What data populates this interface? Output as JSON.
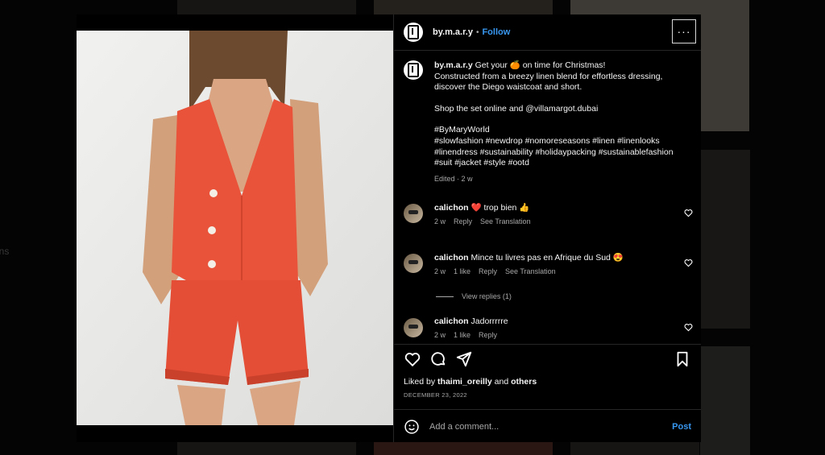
{
  "background": {
    "sidebar_fragments": [
      "s",
      "ons"
    ]
  },
  "post": {
    "username": "by.m.a.r.y",
    "follow_label": "Follow",
    "more_label": "···",
    "caption": {
      "username": "by.m.a.r.y",
      "line1": "Get your 🍊 on time for Christmas!",
      "line2": "Constructed from a breezy linen blend for effortless dressing,",
      "line3": "discover the Diego waistcoat and short.",
      "line4": "Shop the set online and @villamargot.dubai",
      "line5": "#ByMaryWorld",
      "line6": "#slowfashion #newdrop #nomoreseasons #linen #linenlooks",
      "line7": "#linendress #sustainability #holidaypacking #sustainablefashion",
      "line8": "#suit #jacket #style #ootd",
      "meta": "Edited · 2 w"
    },
    "comments": [
      {
        "username": "calichon",
        "text": "❤️ trop bien 👍",
        "time": "2 w",
        "likes": "",
        "reply": "Reply",
        "translate": "See Translation"
      },
      {
        "username": "calichon",
        "text": "Mince tu livres pas en Afrique du Sud 😍",
        "time": "2 w",
        "likes": "1 like",
        "reply": "Reply",
        "translate": "See Translation"
      },
      {
        "username": "calichon",
        "text": "Jadorrrrre",
        "time": "2 w",
        "likes": "1 like",
        "reply": "Reply",
        "translate": ""
      }
    ],
    "view_replies": "View replies (1)",
    "liked_by_prefix": "Liked by",
    "liked_by_user": "thaimi_oreilly",
    "liked_by_and": "and",
    "liked_by_others": "others",
    "date": "DECEMBER 23, 2022",
    "comment_placeholder": "Add a comment...",
    "post_label": "Post"
  }
}
